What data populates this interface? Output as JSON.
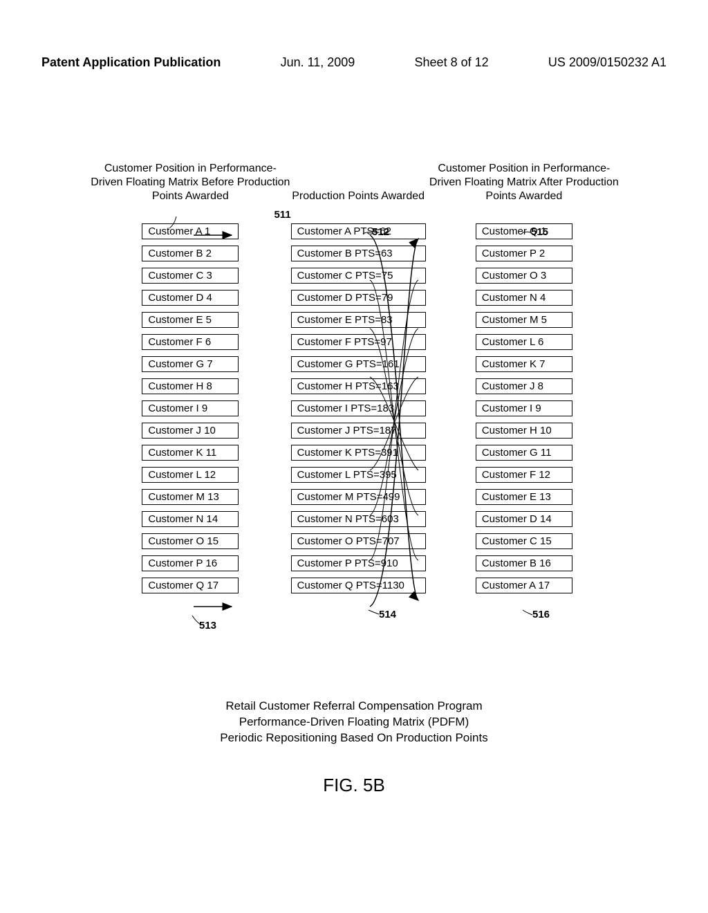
{
  "header": {
    "pub_label": "Patent Application Publication",
    "date": "Jun. 11, 2009",
    "sheet": "Sheet 8 of 12",
    "pub_number": "US 2009/0150232 A1"
  },
  "columns": {
    "before": {
      "title": "Customer Position in Performance-Driven Floating Matrix Before Production Points Awarded",
      "ref_label": "511",
      "items": [
        "Customer A  1",
        "Customer B  2",
        "Customer C  3",
        "Customer D  4",
        "Customer E  5",
        "Customer F  6",
        "Customer G  7",
        "Customer H  8",
        "Customer I  9",
        "Customer J 10",
        "Customer K 11",
        "Customer L 12",
        "Customer M 13",
        "Customer N 14",
        "Customer O 15",
        "Customer P 16",
        "Customer Q 17"
      ]
    },
    "middle": {
      "title": "Production Points Awarded",
      "items": [
        "Customer A PTS=62",
        "Customer B PTS=63",
        "Customer C PTS=75",
        "Customer D PTS=79",
        "Customer E PTS=83",
        "Customer F PTS=97",
        "Customer G PTS=161",
        "Customer H PTS=163",
        "Customer  I PTS=183",
        "Customer J PTS=187",
        "Customer K PTS=391",
        "Customer L PTS=395",
        "Customer M PTS=499",
        "Customer N PTS=603",
        "Customer O PTS=707",
        "Customer P PTS=910",
        "Customer Q PTS=1130"
      ]
    },
    "after": {
      "title": "Customer Position in Performance-Driven Floating Matrix After Production Points Awarded",
      "items": [
        "Customer Q 1",
        "Customer P 2",
        "Customer O 3",
        "Customer N 4",
        "Customer M 5",
        "Customer L 6",
        "Customer K 7",
        "Customer J 8",
        "Customer I 9",
        "Customer H 10",
        "Customer G 11",
        "Customer F 12",
        "Customer E 13",
        "Customer D 14",
        "Customer C 15",
        "Customer B 16",
        "Customer A 17"
      ]
    }
  },
  "callouts": {
    "c511": "511",
    "c512": "512",
    "c513": "513",
    "c514": "514",
    "c515": "515",
    "c516": "516"
  },
  "caption": {
    "line1": "Retail Customer Referral Compensation Program",
    "line2": "Performance-Driven Floating Matrix (PDFM)",
    "line3": "Periodic Repositioning Based On Production Points"
  },
  "figure_label": "FIG. 5B"
}
